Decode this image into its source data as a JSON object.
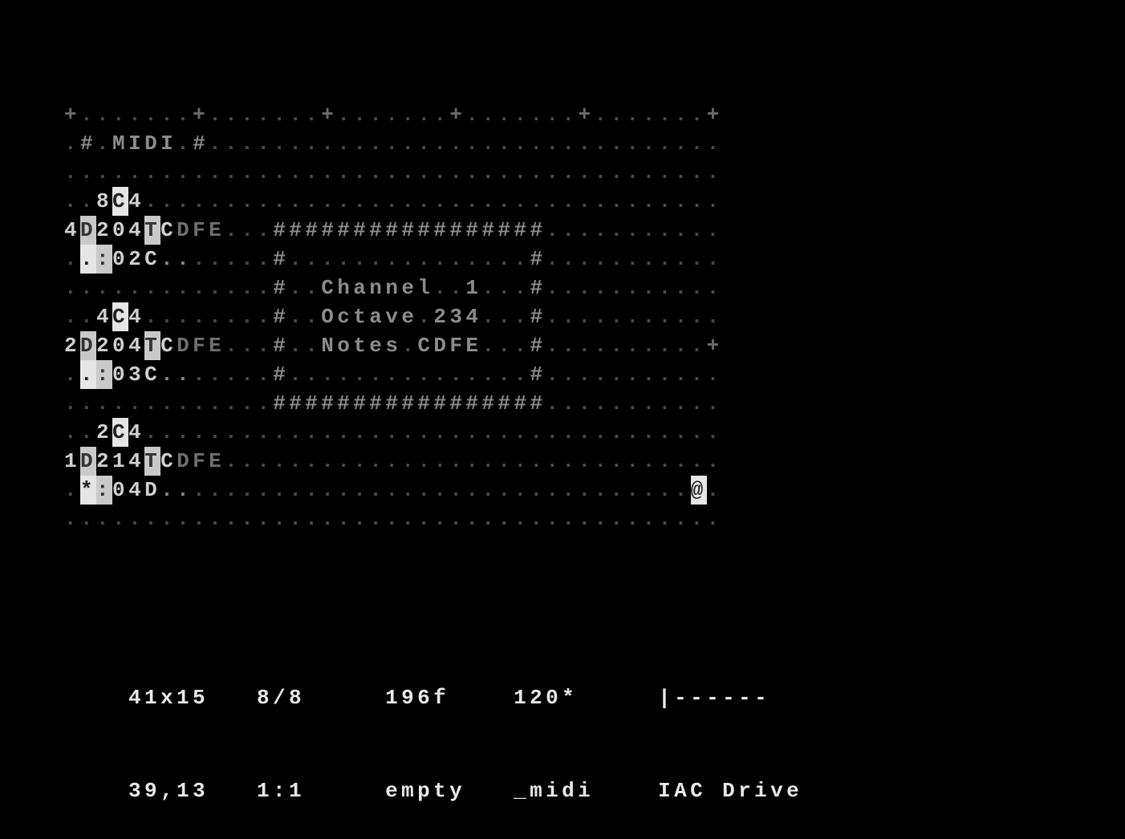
{
  "grid": {
    "cols": 41,
    "rows": 15,
    "cells": [
      {
        "r": 0,
        "c": 0,
        "ch": "+",
        "cls": "c-mark"
      },
      {
        "r": 0,
        "c": 8,
        "ch": "+",
        "cls": "c-mark"
      },
      {
        "r": 0,
        "c": 16,
        "ch": "+",
        "cls": "c-mark"
      },
      {
        "r": 0,
        "c": 24,
        "ch": "+",
        "cls": "c-mark"
      },
      {
        "r": 0,
        "c": 32,
        "ch": "+",
        "cls": "c-mark"
      },
      {
        "r": 0,
        "c": 40,
        "ch": "+",
        "cls": "c-mark"
      },
      {
        "r": 1,
        "c": 1,
        "ch": "#",
        "cls": "c-comment"
      },
      {
        "r": 1,
        "c": 3,
        "ch": "M",
        "cls": "c-comment"
      },
      {
        "r": 1,
        "c": 4,
        "ch": "I",
        "cls": "c-comment"
      },
      {
        "r": 1,
        "c": 5,
        "ch": "D",
        "cls": "c-comment"
      },
      {
        "r": 1,
        "c": 6,
        "ch": "I",
        "cls": "c-comment"
      },
      {
        "r": 1,
        "c": 8,
        "ch": "#",
        "cls": "c-comment"
      },
      {
        "r": 3,
        "c": 2,
        "ch": "8",
        "cls": "c-num"
      },
      {
        "r": 3,
        "c": 3,
        "ch": "C",
        "cls": "c-sel"
      },
      {
        "r": 3,
        "c": 4,
        "ch": "4",
        "cls": "c-num"
      },
      {
        "r": 4,
        "c": 0,
        "ch": "4",
        "cls": "c-num"
      },
      {
        "r": 4,
        "c": 1,
        "ch": "D",
        "cls": "c-op-bg"
      },
      {
        "r": 4,
        "c": 2,
        "ch": "2",
        "cls": "c-num"
      },
      {
        "r": 4,
        "c": 3,
        "ch": "0",
        "cls": "c-num"
      },
      {
        "r": 4,
        "c": 4,
        "ch": "4",
        "cls": "c-num"
      },
      {
        "r": 4,
        "c": 5,
        "ch": "T",
        "cls": "c-op-bg"
      },
      {
        "r": 4,
        "c": 6,
        "ch": "C",
        "cls": "c-num"
      },
      {
        "r": 4,
        "c": 7,
        "ch": "D",
        "cls": "c-faint"
      },
      {
        "r": 4,
        "c": 8,
        "ch": "F",
        "cls": "c-faint"
      },
      {
        "r": 4,
        "c": 9,
        "ch": "E",
        "cls": "c-faint"
      },
      {
        "r": 4,
        "c": 13,
        "ch": "#",
        "cls": "c-comment"
      },
      {
        "r": 4,
        "c": 14,
        "ch": "#",
        "cls": "c-comment"
      },
      {
        "r": 4,
        "c": 15,
        "ch": "#",
        "cls": "c-comment"
      },
      {
        "r": 4,
        "c": 16,
        "ch": "#",
        "cls": "c-comment"
      },
      {
        "r": 4,
        "c": 17,
        "ch": "#",
        "cls": "c-comment"
      },
      {
        "r": 4,
        "c": 18,
        "ch": "#",
        "cls": "c-comment"
      },
      {
        "r": 4,
        "c": 19,
        "ch": "#",
        "cls": "c-comment"
      },
      {
        "r": 4,
        "c": 20,
        "ch": "#",
        "cls": "c-comment"
      },
      {
        "r": 4,
        "c": 21,
        "ch": "#",
        "cls": "c-comment"
      },
      {
        "r": 4,
        "c": 22,
        "ch": "#",
        "cls": "c-comment"
      },
      {
        "r": 4,
        "c": 23,
        "ch": "#",
        "cls": "c-comment"
      },
      {
        "r": 4,
        "c": 24,
        "ch": "#",
        "cls": "c-comment"
      },
      {
        "r": 4,
        "c": 25,
        "ch": "#",
        "cls": "c-comment"
      },
      {
        "r": 4,
        "c": 26,
        "ch": "#",
        "cls": "c-comment"
      },
      {
        "r": 4,
        "c": 27,
        "ch": "#",
        "cls": "c-comment"
      },
      {
        "r": 4,
        "c": 28,
        "ch": "#",
        "cls": "c-comment"
      },
      {
        "r": 4,
        "c": 29,
        "ch": "#",
        "cls": "c-comment"
      },
      {
        "r": 5,
        "c": 1,
        "ch": ".",
        "cls": "c-sel"
      },
      {
        "r": 5,
        "c": 2,
        "ch": ":",
        "cls": "c-op-bg"
      },
      {
        "r": 5,
        "c": 3,
        "ch": "0",
        "cls": "c-num"
      },
      {
        "r": 5,
        "c": 4,
        "ch": "2",
        "cls": "c-num"
      },
      {
        "r": 5,
        "c": 5,
        "ch": "C",
        "cls": "c-num"
      },
      {
        "r": 5,
        "c": 6,
        "ch": ".",
        "cls": "c-lo"
      },
      {
        "r": 5,
        "c": 7,
        "ch": ".",
        "cls": "c-lo"
      },
      {
        "r": 5,
        "c": 13,
        "ch": "#",
        "cls": "c-comment"
      },
      {
        "r": 5,
        "c": 29,
        "ch": "#",
        "cls": "c-comment"
      },
      {
        "r": 6,
        "c": 13,
        "ch": "#",
        "cls": "c-comment"
      },
      {
        "r": 6,
        "c": 16,
        "ch": "C",
        "cls": "c-comment"
      },
      {
        "r": 6,
        "c": 17,
        "ch": "h",
        "cls": "c-comment"
      },
      {
        "r": 6,
        "c": 18,
        "ch": "a",
        "cls": "c-comment"
      },
      {
        "r": 6,
        "c": 19,
        "ch": "n",
        "cls": "c-comment"
      },
      {
        "r": 6,
        "c": 20,
        "ch": "n",
        "cls": "c-comment"
      },
      {
        "r": 6,
        "c": 21,
        "ch": "e",
        "cls": "c-comment"
      },
      {
        "r": 6,
        "c": 22,
        "ch": "l",
        "cls": "c-comment"
      },
      {
        "r": 6,
        "c": 25,
        "ch": "1",
        "cls": "c-comment"
      },
      {
        "r": 6,
        "c": 29,
        "ch": "#",
        "cls": "c-comment"
      },
      {
        "r": 7,
        "c": 2,
        "ch": "4",
        "cls": "c-num"
      },
      {
        "r": 7,
        "c": 3,
        "ch": "C",
        "cls": "c-sel"
      },
      {
        "r": 7,
        "c": 4,
        "ch": "4",
        "cls": "c-num"
      },
      {
        "r": 7,
        "c": 13,
        "ch": "#",
        "cls": "c-comment"
      },
      {
        "r": 7,
        "c": 16,
        "ch": "O",
        "cls": "c-comment"
      },
      {
        "r": 7,
        "c": 17,
        "ch": "c",
        "cls": "c-comment"
      },
      {
        "r": 7,
        "c": 18,
        "ch": "t",
        "cls": "c-comment"
      },
      {
        "r": 7,
        "c": 19,
        "ch": "a",
        "cls": "c-comment"
      },
      {
        "r": 7,
        "c": 20,
        "ch": "v",
        "cls": "c-comment"
      },
      {
        "r": 7,
        "c": 21,
        "ch": "e",
        "cls": "c-comment"
      },
      {
        "r": 7,
        "c": 23,
        "ch": "2",
        "cls": "c-comment"
      },
      {
        "r": 7,
        "c": 24,
        "ch": "3",
        "cls": "c-comment"
      },
      {
        "r": 7,
        "c": 25,
        "ch": "4",
        "cls": "c-comment"
      },
      {
        "r": 7,
        "c": 29,
        "ch": "#",
        "cls": "c-comment"
      },
      {
        "r": 8,
        "c": 0,
        "ch": "+",
        "cls": "c-mark"
      },
      {
        "r": 8,
        "c": 0,
        "ch": "2",
        "cls": "c-num",
        "over": true
      },
      {
        "r": 8,
        "c": 1,
        "ch": "D",
        "cls": "c-op-bg"
      },
      {
        "r": 8,
        "c": 2,
        "ch": "2",
        "cls": "c-num"
      },
      {
        "r": 8,
        "c": 3,
        "ch": "0",
        "cls": "c-num"
      },
      {
        "r": 8,
        "c": 4,
        "ch": "4",
        "cls": "c-num"
      },
      {
        "r": 8,
        "c": 5,
        "ch": "T",
        "cls": "c-op-bg"
      },
      {
        "r": 8,
        "c": 6,
        "ch": "C",
        "cls": "c-num"
      },
      {
        "r": 8,
        "c": 7,
        "ch": "D",
        "cls": "c-faint"
      },
      {
        "r": 8,
        "c": 8,
        "ch": "F",
        "cls": "c-faint"
      },
      {
        "r": 8,
        "c": 9,
        "ch": "E",
        "cls": "c-faint"
      },
      {
        "r": 8,
        "c": 13,
        "ch": "#",
        "cls": "c-comment"
      },
      {
        "r": 8,
        "c": 16,
        "ch": "N",
        "cls": "c-comment"
      },
      {
        "r": 8,
        "c": 17,
        "ch": "o",
        "cls": "c-comment"
      },
      {
        "r": 8,
        "c": 18,
        "ch": "t",
        "cls": "c-comment"
      },
      {
        "r": 8,
        "c": 19,
        "ch": "e",
        "cls": "c-comment"
      },
      {
        "r": 8,
        "c": 20,
        "ch": "s",
        "cls": "c-comment"
      },
      {
        "r": 8,
        "c": 22,
        "ch": "C",
        "cls": "c-comment"
      },
      {
        "r": 8,
        "c": 23,
        "ch": "D",
        "cls": "c-comment"
      },
      {
        "r": 8,
        "c": 24,
        "ch": "F",
        "cls": "c-comment"
      },
      {
        "r": 8,
        "c": 25,
        "ch": "E",
        "cls": "c-comment"
      },
      {
        "r": 8,
        "c": 29,
        "ch": "#",
        "cls": "c-comment"
      },
      {
        "r": 8,
        "c": 40,
        "ch": "+",
        "cls": "c-mark"
      },
      {
        "r": 9,
        "c": 1,
        "ch": ".",
        "cls": "c-sel"
      },
      {
        "r": 9,
        "c": 2,
        "ch": ":",
        "cls": "c-op-bg"
      },
      {
        "r": 9,
        "c": 3,
        "ch": "0",
        "cls": "c-num"
      },
      {
        "r": 9,
        "c": 4,
        "ch": "3",
        "cls": "c-num"
      },
      {
        "r": 9,
        "c": 5,
        "ch": "C",
        "cls": "c-num"
      },
      {
        "r": 9,
        "c": 6,
        "ch": ".",
        "cls": "c-lo"
      },
      {
        "r": 9,
        "c": 7,
        "ch": ".",
        "cls": "c-lo"
      },
      {
        "r": 9,
        "c": 13,
        "ch": "#",
        "cls": "c-comment"
      },
      {
        "r": 9,
        "c": 29,
        "ch": "#",
        "cls": "c-comment"
      },
      {
        "r": 10,
        "c": 13,
        "ch": "#",
        "cls": "c-comment"
      },
      {
        "r": 10,
        "c": 14,
        "ch": "#",
        "cls": "c-comment"
      },
      {
        "r": 10,
        "c": 15,
        "ch": "#",
        "cls": "c-comment"
      },
      {
        "r": 10,
        "c": 16,
        "ch": "#",
        "cls": "c-comment"
      },
      {
        "r": 10,
        "c": 17,
        "ch": "#",
        "cls": "c-comment"
      },
      {
        "r": 10,
        "c": 18,
        "ch": "#",
        "cls": "c-comment"
      },
      {
        "r": 10,
        "c": 19,
        "ch": "#",
        "cls": "c-comment"
      },
      {
        "r": 10,
        "c": 20,
        "ch": "#",
        "cls": "c-comment"
      },
      {
        "r": 10,
        "c": 21,
        "ch": "#",
        "cls": "c-comment"
      },
      {
        "r": 10,
        "c": 22,
        "ch": "#",
        "cls": "c-comment"
      },
      {
        "r": 10,
        "c": 23,
        "ch": "#",
        "cls": "c-comment"
      },
      {
        "r": 10,
        "c": 24,
        "ch": "#",
        "cls": "c-comment"
      },
      {
        "r": 10,
        "c": 25,
        "ch": "#",
        "cls": "c-comment"
      },
      {
        "r": 10,
        "c": 26,
        "ch": "#",
        "cls": "c-comment"
      },
      {
        "r": 10,
        "c": 27,
        "ch": "#",
        "cls": "c-comment"
      },
      {
        "r": 10,
        "c": 28,
        "ch": "#",
        "cls": "c-comment"
      },
      {
        "r": 10,
        "c": 29,
        "ch": "#",
        "cls": "c-comment"
      },
      {
        "r": 11,
        "c": 2,
        "ch": "2",
        "cls": "c-num"
      },
      {
        "r": 11,
        "c": 3,
        "ch": "C",
        "cls": "c-sel"
      },
      {
        "r": 11,
        "c": 4,
        "ch": "4",
        "cls": "c-num"
      },
      {
        "r": 12,
        "c": 0,
        "ch": "1",
        "cls": "c-num"
      },
      {
        "r": 12,
        "c": 1,
        "ch": "D",
        "cls": "c-op-bg"
      },
      {
        "r": 12,
        "c": 2,
        "ch": "2",
        "cls": "c-num"
      },
      {
        "r": 12,
        "c": 3,
        "ch": "1",
        "cls": "c-num"
      },
      {
        "r": 12,
        "c": 4,
        "ch": "4",
        "cls": "c-num"
      },
      {
        "r": 12,
        "c": 5,
        "ch": "T",
        "cls": "c-op-bg"
      },
      {
        "r": 12,
        "c": 6,
        "ch": "C",
        "cls": "c-num"
      },
      {
        "r": 12,
        "c": 7,
        "ch": "D",
        "cls": "c-faint"
      },
      {
        "r": 12,
        "c": 8,
        "ch": "F",
        "cls": "c-faint"
      },
      {
        "r": 12,
        "c": 9,
        "ch": "E",
        "cls": "c-faint"
      },
      {
        "r": 13,
        "c": 1,
        "ch": "*",
        "cls": "c-sel"
      },
      {
        "r": 13,
        "c": 2,
        "ch": ":",
        "cls": "c-op-bg"
      },
      {
        "r": 13,
        "c": 3,
        "ch": "0",
        "cls": "c-num"
      },
      {
        "r": 13,
        "c": 4,
        "ch": "4",
        "cls": "c-num"
      },
      {
        "r": 13,
        "c": 5,
        "ch": "D",
        "cls": "c-num"
      },
      {
        "r": 13,
        "c": 6,
        "ch": ".",
        "cls": "c-lo"
      },
      {
        "r": 13,
        "c": 7,
        "ch": ".",
        "cls": "c-lo"
      },
      {
        "r": 13,
        "c": 39,
        "ch": "@",
        "cls": "c-sel"
      }
    ]
  },
  "status": {
    "size": "41x15",
    "frame": "8/8",
    "counter": "196f",
    "bpm": "120*",
    "io": "|------",
    "cursor": "39,13",
    "zoom": "1:1",
    "state": "empty",
    "mode": "_midi",
    "device": "IAC Drive"
  }
}
